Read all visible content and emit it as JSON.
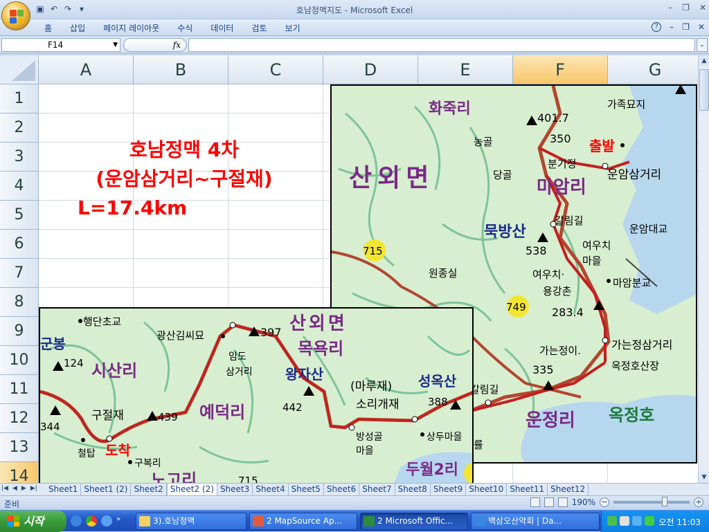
{
  "window": {
    "title": "호남정맥지도 - Microsoft Excel",
    "controls": [
      "–",
      "❐",
      "✕"
    ]
  },
  "ribbon": {
    "tabs": [
      "홈",
      "삽입",
      "페이지 레이아웃",
      "수식",
      "데이터",
      "검토",
      "보기"
    ],
    "help_icon": "?",
    "right_controls": [
      "–",
      "❐",
      "✕"
    ]
  },
  "formula_bar": {
    "name_box": "F14",
    "fx_label": "fx",
    "formula": ""
  },
  "grid": {
    "columns": [
      "A",
      "B",
      "C",
      "D",
      "E",
      "F",
      "G"
    ],
    "selected_column": "F",
    "rows": [
      "1",
      "2",
      "3",
      "4",
      "5",
      "6",
      "7",
      "8",
      "9",
      "10",
      "11",
      "12",
      "13",
      "14"
    ],
    "title_lines": [
      "호남정맥 4차",
      "(운암삼거리~구절재)",
      "L=17.4km"
    ]
  },
  "map_upper": {
    "labels": {
      "hwajuk": "화죽리",
      "sanoe": "산외면",
      "maam": "마암리",
      "mukbang": "묵방산",
      "unjeong": "운정리",
      "okjeongho": "옥정호",
      "peak401": "401.7",
      "elev350": "350",
      "chulbal": "출발",
      "gajok": "가족묘지",
      "nonggol": "농골",
      "danggol": "당골",
      "bungijeong": "분기정",
      "unam": "운암삼거리",
      "galim": "갈림길",
      "unamdaegyo": "운암대교",
      "m538": "538",
      "r715": "715",
      "wonjong": "원종실",
      "yeouchi1": "여우치",
      "maeul": "마을",
      "yeouchi2": "여우치·",
      "yonggang": "용강촌",
      "m283": "283.4",
      "maamboon": "마암분교",
      "r749": "749",
      "gajeongi": "가는정이.",
      "gajeong3": "가는정삼거리",
      "okjeongsan": "옥정호산장",
      "m335": "335",
      "galim2": "갈림길",
      "reul": "률"
    },
    "colors": {
      "road": "#b2462f",
      "water": "#b7d7ee",
      "land": "#d8eed0",
      "village": "#7a2a86",
      "ridge": "#c41e1e"
    }
  },
  "map_lower": {
    "labels": {
      "haengdan": "행단초교",
      "gwangsan": "광산김씨묘",
      "m397": "397",
      "sanoe": "산외면",
      "mokyok": "목욕리",
      "gunbong": "군봉",
      "m124": "124",
      "sisan": "시산리",
      "imdo1": "임도",
      "imdo2": "삼거리",
      "wangja": "왕자산",
      "marujae": "(마루재)",
      "seongok": "성옥산",
      "sori": "소리개재",
      "m388": "388",
      "m344": "344",
      "gujeol": "구절재",
      "m439": "439",
      "yedeok": "예덕리",
      "m442": "442",
      "bangseong1": "방성골",
      "bangseong2": "마을",
      "sangdu": "상두마을",
      "dowol": "두월2리",
      "cheoltap": "철탑",
      "dochak": "도착",
      "gubok": "구복리",
      "nogo": "노고리",
      "r715": "715"
    }
  },
  "sheets": {
    "tabs": [
      "Sheet1",
      "Sheet1 (2)",
      "Sheet2",
      "Sheet2 (2)",
      "Sheet3",
      "Sheet4",
      "Sheet5",
      "Sheet6",
      "Sheet7",
      "Sheet8",
      "Sheet9",
      "Sheet10",
      "Sheet11",
      "Sheet12"
    ],
    "active": "Sheet2 (2)"
  },
  "status": {
    "mode": "준비",
    "zoom": "190%"
  },
  "taskbar": {
    "start": "시작",
    "tasks": [
      "3).호남정맥",
      "2 MapSource Ap...",
      "2 Microsoft Offic...",
      "백삼오산악회 | Da..."
    ],
    "active_task": 2,
    "clock": "오전 11:03"
  }
}
